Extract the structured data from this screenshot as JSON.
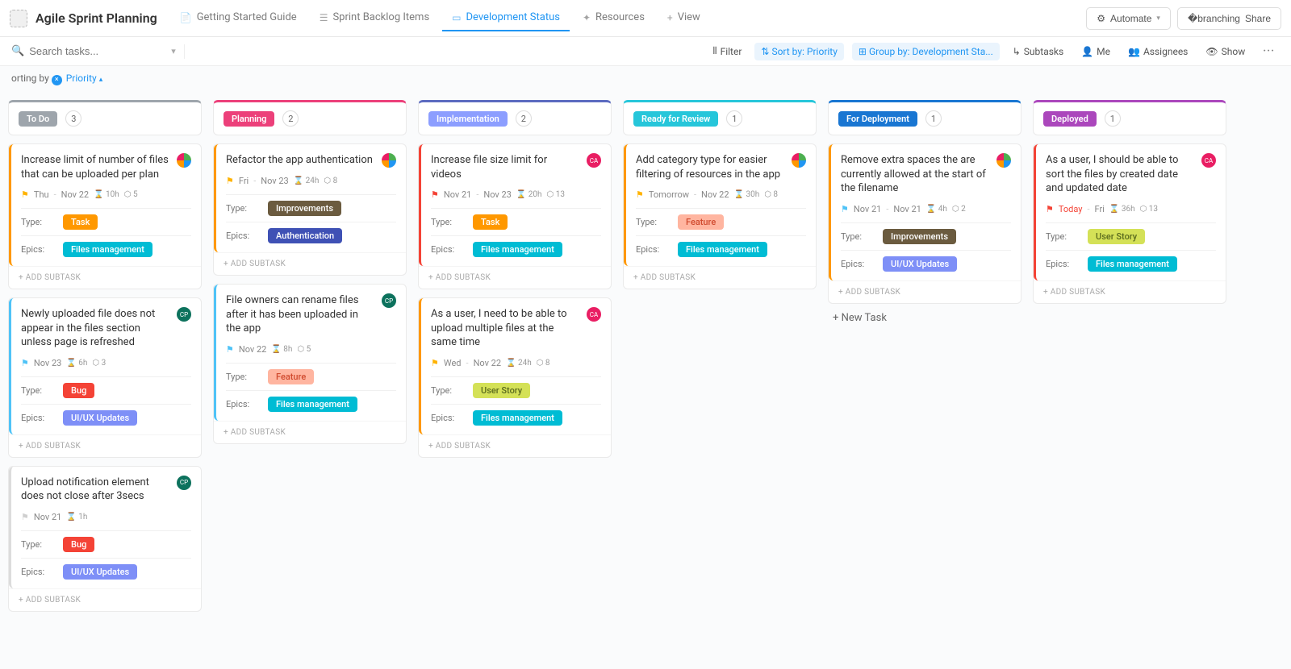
{
  "header": {
    "title": "Agile Sprint Planning",
    "tabs": [
      {
        "label": "Getting Started Guide"
      },
      {
        "label": "Sprint Backlog Items"
      },
      {
        "label": "Development Status"
      },
      {
        "label": "Resources"
      },
      {
        "label": "View"
      }
    ],
    "automate": "Automate",
    "share": "Share"
  },
  "toolbar": {
    "search_placeholder": "Search tasks...",
    "filter": "Filter",
    "sort_by": "Sort by: Priority",
    "group_by": "Group by: Development Sta...",
    "subtasks": "Subtasks",
    "me": "Me",
    "assignees": "Assignees",
    "show": "Show"
  },
  "sortbar": {
    "prefix": "orting by",
    "value": "Priority"
  },
  "add_subtask": "+ ADD SUBTASK",
  "new_task": "+ New Task",
  "field_labels": {
    "type": "Type:",
    "epics": "Epics:"
  },
  "columns": [
    {
      "name": "To Do",
      "count": "3",
      "color": "#9ea5ac",
      "border": "#9ea5ac",
      "cards": [
        {
          "title": "Increase limit of number of files that can be uploaded per plan",
          "avatar_type": "sprite",
          "flag_color": "#ffb300",
          "dates": [
            "Thu",
            "Nov 22"
          ],
          "hours": "10h",
          "points": "5",
          "type": {
            "label": "Task",
            "cls": "tag-task"
          },
          "epics": {
            "label": "Files management",
            "cls": "tag-files"
          },
          "stripe": "#ff9800"
        },
        {
          "title": "Newly uploaded file does not appear in the files section unless page is refreshed",
          "avatar_color": "#0d725d",
          "avatar_text": "CP",
          "flag_color": "#4fc3f7",
          "dates": [
            "Nov 23"
          ],
          "hours": "6h",
          "points": "3",
          "type": {
            "label": "Bug",
            "cls": "tag-bug"
          },
          "epics": {
            "label": "UI/UX Updates",
            "cls": "tag-uiux"
          },
          "stripe": "#4fc3f7"
        },
        {
          "title": "Upload notification element does not close after 3secs",
          "avatar_color": "#0d725d",
          "avatar_text": "CP",
          "flag_color": "#cfcfcf",
          "dates": [
            "Nov 21"
          ],
          "hours": "1h",
          "points": "",
          "type": {
            "label": "Bug",
            "cls": "tag-bug"
          },
          "epics": {
            "label": "UI/UX Updates",
            "cls": "tag-uiux"
          },
          "stripe": "#dcdcdc"
        }
      ]
    },
    {
      "name": "Planning",
      "count": "2",
      "color": "#ec407a",
      "border": "#ec407a",
      "cards": [
        {
          "title": "Refactor the app authentication",
          "avatar_type": "sprite",
          "flag_color": "#ffb300",
          "dates": [
            "Fri",
            "Nov 23"
          ],
          "hours": "24h",
          "points": "8",
          "type": {
            "label": "Improvements",
            "cls": "tag-improvements"
          },
          "epics": {
            "label": "Authentication",
            "cls": "tag-auth"
          },
          "stripe": "#ff9800"
        },
        {
          "title": "File owners can rename files after it has been uploaded in the app",
          "avatar_color": "#0d725d",
          "avatar_text": "CP",
          "flag_color": "#4fc3f7",
          "dates": [
            "Nov 22"
          ],
          "hours": "8h",
          "points": "5",
          "type": {
            "label": "Feature",
            "cls": "tag-feature"
          },
          "epics": {
            "label": "Files management",
            "cls": "tag-files"
          },
          "stripe": "#4fc3f7"
        }
      ]
    },
    {
      "name": "Implementation",
      "count": "2",
      "color": "#8c9eff",
      "border": "#5c6bc0",
      "cards": [
        {
          "title": "Increase file size limit for videos",
          "avatar_color": "#e91e63",
          "avatar_text": "CA",
          "flag_color": "#f44336",
          "dates": [
            "Nov 21",
            "Nov 23"
          ],
          "hours": "20h",
          "points": "13",
          "type": {
            "label": "Task",
            "cls": "tag-task"
          },
          "epics": {
            "label": "Files management",
            "cls": "tag-files"
          },
          "stripe": "#f44336"
        },
        {
          "title": "As a user, I need to be able to upload multiple files at the same time",
          "avatar_color": "#e91e63",
          "avatar_text": "CA",
          "flag_color": "#ffb300",
          "dates": [
            "Wed",
            "Nov 22"
          ],
          "hours": "24h",
          "points": "8",
          "type": {
            "label": "User Story",
            "cls": "tag-userstory"
          },
          "epics": {
            "label": "Files management",
            "cls": "tag-files"
          },
          "stripe": "#ff9800"
        }
      ]
    },
    {
      "name": "Ready for Review",
      "count": "1",
      "color": "#26c6da",
      "border": "#26c6da",
      "cards": [
        {
          "title": "Add category type for easier filtering of resources in the app",
          "avatar_type": "sprite",
          "flag_color": "#ffb300",
          "dates": [
            "Tomorrow",
            "Nov 22"
          ],
          "hours": "30h",
          "points": "8",
          "type": {
            "label": "Feature",
            "cls": "tag-feature"
          },
          "epics": {
            "label": "Files management",
            "cls": "tag-files"
          },
          "stripe": "#ff9800"
        }
      ]
    },
    {
      "name": "For Deployment",
      "count": "1",
      "color": "#1976d2",
      "border": "#1976d2",
      "cards": [
        {
          "title": "Remove extra spaces the are currently allowed at the start of the filename",
          "avatar_type": "sprite",
          "flag_color": "#4fc3f7",
          "dates": [
            "Nov 21",
            "Nov 21"
          ],
          "hours": "4h",
          "points": "2",
          "type": {
            "label": "Improvements",
            "cls": "tag-improvements"
          },
          "epics": {
            "label": "UI/UX Updates",
            "cls": "tag-uiux"
          },
          "stripe": "#ff9800"
        }
      ],
      "show_new_task": true
    },
    {
      "name": "Deployed",
      "count": "1",
      "color": "#ab47bc",
      "border": "#ab47bc",
      "cards": [
        {
          "title": "As a user, I should be able to sort the files by created date and updated date",
          "avatar_color": "#e91e63",
          "avatar_text": "CA",
          "flag_color": "#f44336",
          "dates": [
            "Today",
            "Fri"
          ],
          "date_colors": [
            "#f44336",
            null
          ],
          "hours": "36h",
          "points": "13",
          "type": {
            "label": "User Story",
            "cls": "tag-userstory"
          },
          "epics": {
            "label": "Files management",
            "cls": "tag-files"
          },
          "stripe": "#f44336"
        }
      ]
    }
  ]
}
